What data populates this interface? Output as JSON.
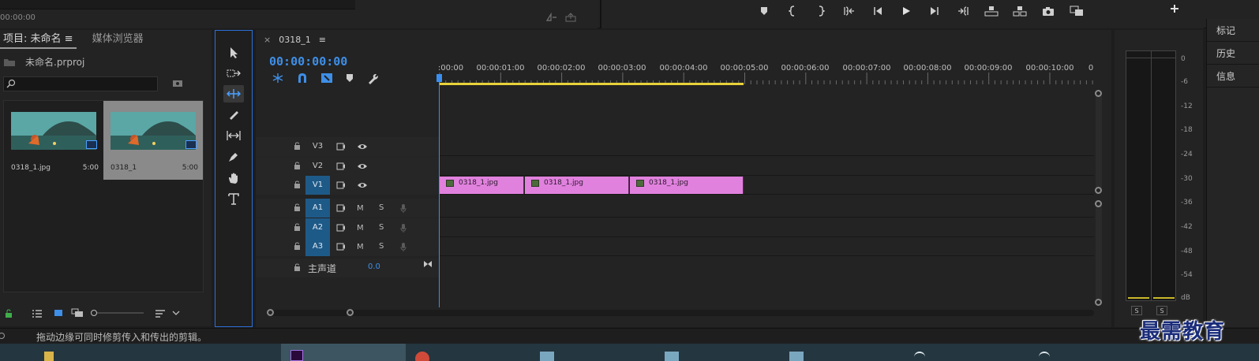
{
  "source_monitor": {
    "timecode": "00:00:00"
  },
  "project": {
    "tab_project": "项目: 未命名",
    "tab_media": "媒体浏览器",
    "file_name": "未命名.prproj",
    "items": [
      {
        "name": "0318_1.jpg",
        "duration": "5:00"
      },
      {
        "name": "0318_1",
        "duration": "5:00"
      }
    ]
  },
  "timeline": {
    "tab_label": "0318_1",
    "timecode": "00:00:00:00",
    "ruler": [
      ":00:00",
      "00:00:01:00",
      "00:00:02:00",
      "00:00:03:00",
      "00:00:04:00",
      "00:00:05:00",
      "00:00:06:00",
      "00:00:07:00",
      "00:00:08:00",
      "00:00:09:00",
      "00:00:10:00",
      "0"
    ],
    "video_tracks": [
      "V3",
      "V2",
      "V1"
    ],
    "audio_tracks": [
      "A1",
      "A2",
      "A3"
    ],
    "mute_label": "M",
    "solo_label": "S",
    "master_label": "主声道",
    "master_value": "0.0",
    "clips": [
      {
        "name": "0318_1.jpg"
      },
      {
        "name": "0318_1.jpg"
      },
      {
        "name": "0318_1.jpg"
      }
    ]
  },
  "meter": {
    "db_labels": [
      "0",
      "-6",
      "-12",
      "-18",
      "-24",
      "-30",
      "-36",
      "-42",
      "-48",
      "-54",
      "dB"
    ],
    "solo_left": "S",
    "solo_right": "S"
  },
  "side_tabs": [
    "标记",
    "历史",
    "信息"
  ],
  "status": {
    "text": "拖动边缘可同时修剪传入和传出的剪辑。"
  },
  "watermark": "最需教育",
  "colors": {
    "accent": "#3e8fe8",
    "clip": "#e181de",
    "track_on": "#1e5a88",
    "work_area": "#e8d23a"
  }
}
